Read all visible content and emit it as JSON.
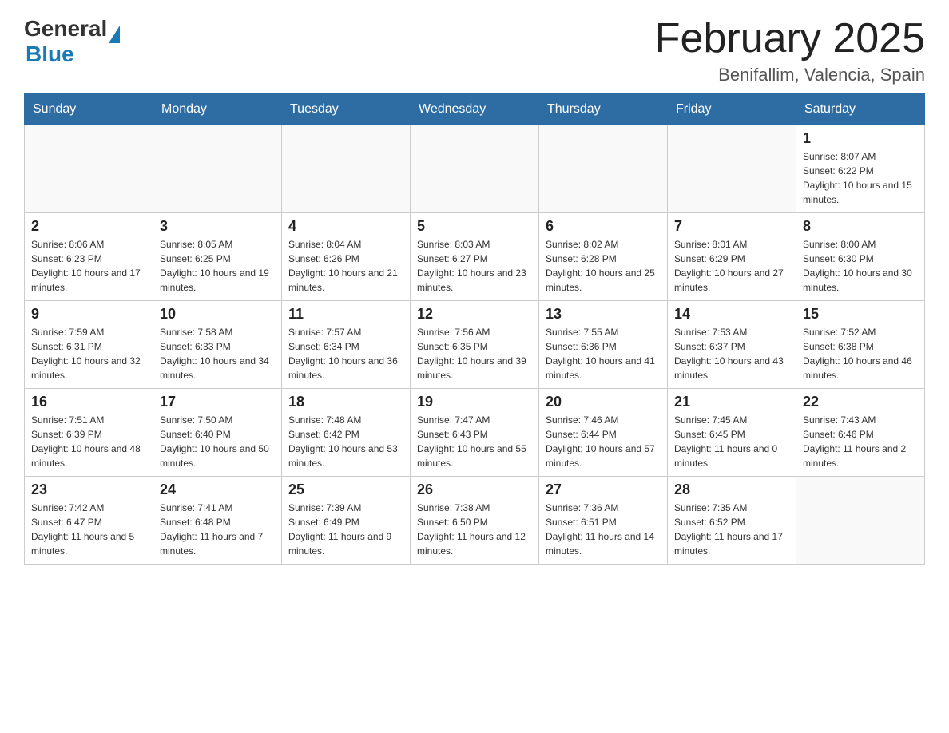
{
  "header": {
    "logo_general": "General",
    "logo_blue": "Blue",
    "title": "February 2025",
    "subtitle": "Benifallim, Valencia, Spain"
  },
  "days_of_week": [
    "Sunday",
    "Monday",
    "Tuesday",
    "Wednesday",
    "Thursday",
    "Friday",
    "Saturday"
  ],
  "weeks": [
    [
      {
        "day": "",
        "info": ""
      },
      {
        "day": "",
        "info": ""
      },
      {
        "day": "",
        "info": ""
      },
      {
        "day": "",
        "info": ""
      },
      {
        "day": "",
        "info": ""
      },
      {
        "day": "",
        "info": ""
      },
      {
        "day": "1",
        "info": "Sunrise: 8:07 AM\nSunset: 6:22 PM\nDaylight: 10 hours and 15 minutes."
      }
    ],
    [
      {
        "day": "2",
        "info": "Sunrise: 8:06 AM\nSunset: 6:23 PM\nDaylight: 10 hours and 17 minutes."
      },
      {
        "day": "3",
        "info": "Sunrise: 8:05 AM\nSunset: 6:25 PM\nDaylight: 10 hours and 19 minutes."
      },
      {
        "day": "4",
        "info": "Sunrise: 8:04 AM\nSunset: 6:26 PM\nDaylight: 10 hours and 21 minutes."
      },
      {
        "day": "5",
        "info": "Sunrise: 8:03 AM\nSunset: 6:27 PM\nDaylight: 10 hours and 23 minutes."
      },
      {
        "day": "6",
        "info": "Sunrise: 8:02 AM\nSunset: 6:28 PM\nDaylight: 10 hours and 25 minutes."
      },
      {
        "day": "7",
        "info": "Sunrise: 8:01 AM\nSunset: 6:29 PM\nDaylight: 10 hours and 27 minutes."
      },
      {
        "day": "8",
        "info": "Sunrise: 8:00 AM\nSunset: 6:30 PM\nDaylight: 10 hours and 30 minutes."
      }
    ],
    [
      {
        "day": "9",
        "info": "Sunrise: 7:59 AM\nSunset: 6:31 PM\nDaylight: 10 hours and 32 minutes."
      },
      {
        "day": "10",
        "info": "Sunrise: 7:58 AM\nSunset: 6:33 PM\nDaylight: 10 hours and 34 minutes."
      },
      {
        "day": "11",
        "info": "Sunrise: 7:57 AM\nSunset: 6:34 PM\nDaylight: 10 hours and 36 minutes."
      },
      {
        "day": "12",
        "info": "Sunrise: 7:56 AM\nSunset: 6:35 PM\nDaylight: 10 hours and 39 minutes."
      },
      {
        "day": "13",
        "info": "Sunrise: 7:55 AM\nSunset: 6:36 PM\nDaylight: 10 hours and 41 minutes."
      },
      {
        "day": "14",
        "info": "Sunrise: 7:53 AM\nSunset: 6:37 PM\nDaylight: 10 hours and 43 minutes."
      },
      {
        "day": "15",
        "info": "Sunrise: 7:52 AM\nSunset: 6:38 PM\nDaylight: 10 hours and 46 minutes."
      }
    ],
    [
      {
        "day": "16",
        "info": "Sunrise: 7:51 AM\nSunset: 6:39 PM\nDaylight: 10 hours and 48 minutes."
      },
      {
        "day": "17",
        "info": "Sunrise: 7:50 AM\nSunset: 6:40 PM\nDaylight: 10 hours and 50 minutes."
      },
      {
        "day": "18",
        "info": "Sunrise: 7:48 AM\nSunset: 6:42 PM\nDaylight: 10 hours and 53 minutes."
      },
      {
        "day": "19",
        "info": "Sunrise: 7:47 AM\nSunset: 6:43 PM\nDaylight: 10 hours and 55 minutes."
      },
      {
        "day": "20",
        "info": "Sunrise: 7:46 AM\nSunset: 6:44 PM\nDaylight: 10 hours and 57 minutes."
      },
      {
        "day": "21",
        "info": "Sunrise: 7:45 AM\nSunset: 6:45 PM\nDaylight: 11 hours and 0 minutes."
      },
      {
        "day": "22",
        "info": "Sunrise: 7:43 AM\nSunset: 6:46 PM\nDaylight: 11 hours and 2 minutes."
      }
    ],
    [
      {
        "day": "23",
        "info": "Sunrise: 7:42 AM\nSunset: 6:47 PM\nDaylight: 11 hours and 5 minutes."
      },
      {
        "day": "24",
        "info": "Sunrise: 7:41 AM\nSunset: 6:48 PM\nDaylight: 11 hours and 7 minutes."
      },
      {
        "day": "25",
        "info": "Sunrise: 7:39 AM\nSunset: 6:49 PM\nDaylight: 11 hours and 9 minutes."
      },
      {
        "day": "26",
        "info": "Sunrise: 7:38 AM\nSunset: 6:50 PM\nDaylight: 11 hours and 12 minutes."
      },
      {
        "day": "27",
        "info": "Sunrise: 7:36 AM\nSunset: 6:51 PM\nDaylight: 11 hours and 14 minutes."
      },
      {
        "day": "28",
        "info": "Sunrise: 7:35 AM\nSunset: 6:52 PM\nDaylight: 11 hours and 17 minutes."
      },
      {
        "day": "",
        "info": ""
      }
    ]
  ]
}
